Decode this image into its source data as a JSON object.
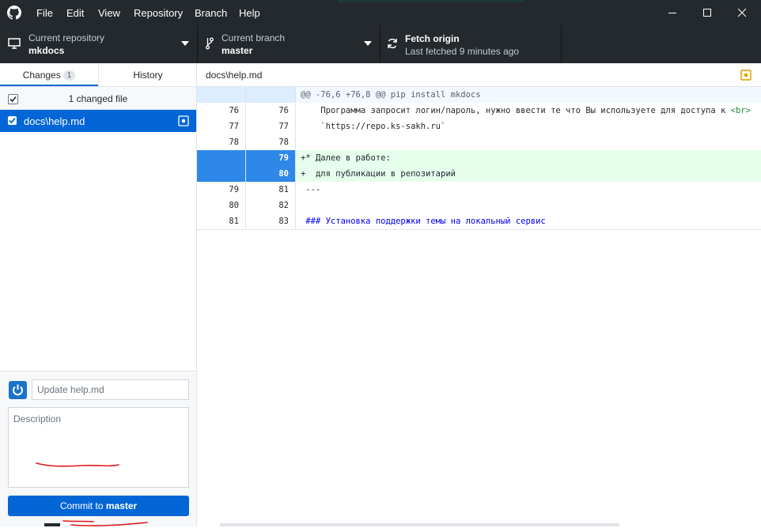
{
  "menu": [
    "File",
    "Edit",
    "View",
    "Repository",
    "Branch",
    "Help"
  ],
  "toolbar": {
    "repo": {
      "label": "Current repository",
      "value": "mkdocs"
    },
    "branch": {
      "label": "Current branch",
      "value": "master"
    },
    "fetch": {
      "label": "Fetch origin",
      "status": "Last fetched 9 minutes ago"
    }
  },
  "tabs": {
    "changes": {
      "label": "Changes",
      "count": "1"
    },
    "history": {
      "label": "History"
    }
  },
  "changes": {
    "header": "1 changed file",
    "files": [
      {
        "path": "docs\\help.md"
      }
    ]
  },
  "commit": {
    "summary_placeholder": "Update help.md",
    "description_placeholder": "Description",
    "button_prefix": "Commit to ",
    "branch": "master"
  },
  "diff": {
    "file_path": "docs\\help.md",
    "hunk": "@@ -76,6 +76,8 @@ pip install mkdocs",
    "lines": [
      {
        "old": "76",
        "new": "76",
        "type": "context",
        "text": "    Программа запросит логин/пароль, нужно ввести те что Вы используете для доступа к ",
        "tag": "<br>"
      },
      {
        "old": "77",
        "new": "77",
        "type": "context",
        "text": "    `https://repo.ks-sakh.ru`"
      },
      {
        "old": "78",
        "new": "78",
        "type": "context",
        "text": ""
      },
      {
        "old": "",
        "new": "79",
        "type": "added",
        "text": "+* Далее в работе:"
      },
      {
        "old": "",
        "new": "80",
        "type": "added",
        "text": "+  для публикации в репозитарий"
      },
      {
        "old": "79",
        "new": "81",
        "type": "context",
        "text": " ---"
      },
      {
        "old": "80",
        "new": "82",
        "type": "context",
        "text": ""
      },
      {
        "old": "81",
        "new": "83",
        "type": "context",
        "text": " ### Установка поддержки темы на локальный сервис",
        "color": "#0000ee"
      }
    ]
  },
  "colors": {
    "accent": "#0366d6",
    "titlebar": "#24292e",
    "added_bg": "#e6ffed",
    "hunk_bg": "#f1f8ff",
    "annotation": "#e0161c"
  }
}
